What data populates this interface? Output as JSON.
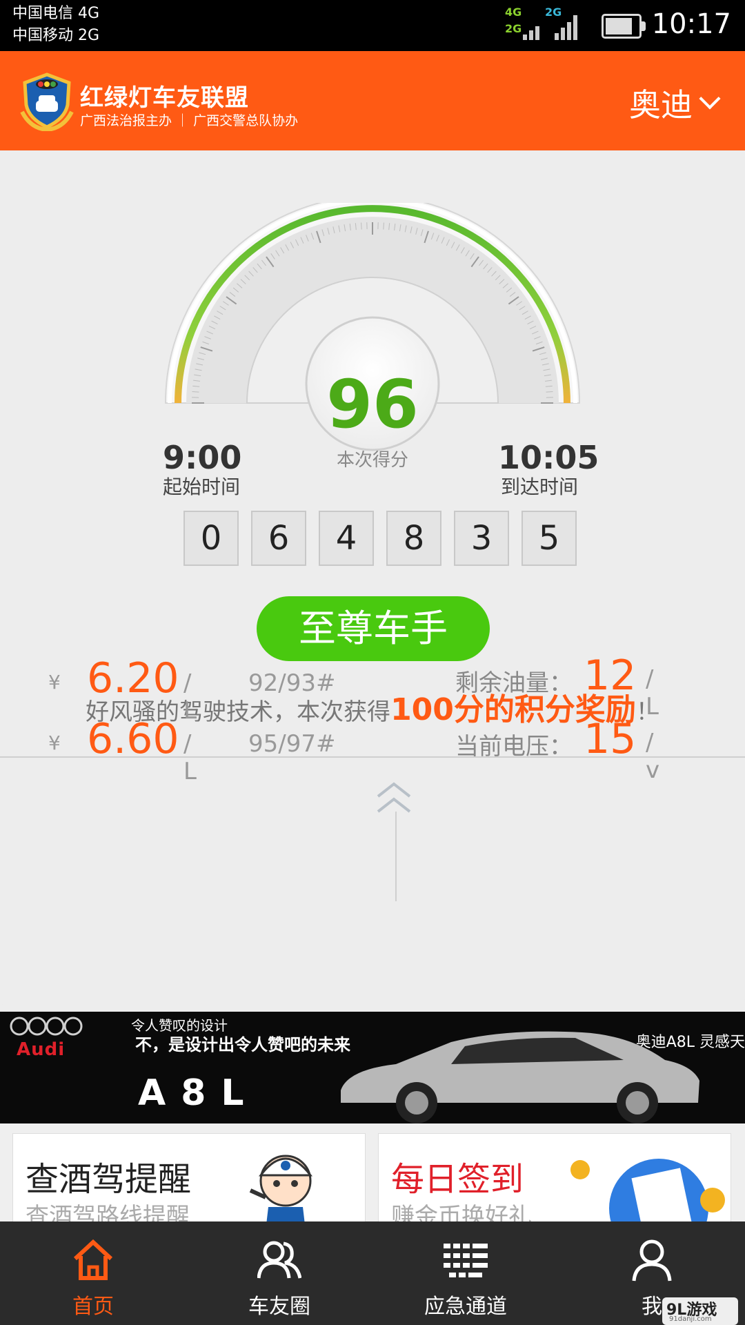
{
  "status_bar": {
    "carrier_1": "中国电信 4G",
    "carrier_2": "中国移动 2G",
    "net_tag_1": "4G",
    "net_tag_2": "2G",
    "net_tag_3": "2G",
    "time": "10:17"
  },
  "header": {
    "title": "红绿灯车友联盟",
    "subtitle": "广西法治报主办 ｜ 广西交警总队协办",
    "brand_selector": "奥迪"
  },
  "gauge": {
    "score": "96",
    "score_label": "本次得分",
    "score_fraction": 0.96,
    "start_time": "9:00",
    "start_time_label": "起始时间",
    "arrival_time": "10:05",
    "arrival_time_label": "到达时间"
  },
  "odometer": [
    "0",
    "6",
    "4",
    "8",
    "3",
    "5"
  ],
  "rank_button": "至尊车手",
  "message": {
    "prefix": "好风骚的驾驶技术，本次获得",
    "highlight": "100分的积分奖励",
    "suffix": "！"
  },
  "fuel_prices": [
    {
      "currency": "¥",
      "price": "6.20",
      "unit": "/ L",
      "grade": "92/93#"
    },
    {
      "currency": "¥",
      "price": "6.60",
      "unit": "/ L",
      "grade": "95/97#"
    }
  ],
  "vehicle_info": [
    {
      "label": "剩余油量：",
      "value": "12",
      "unit": "/ L"
    },
    {
      "label": "当前电压：",
      "value": "15",
      "unit": "/ v"
    }
  ],
  "ad_banner": {
    "slogan_line1": "令人赞叹的设计",
    "slogan_line2": "不，是设计出令人赞吧的未来",
    "brand": "Audi",
    "model": "A8L",
    "tagline": "奥迪A8L 灵感天"
  },
  "tiles": [
    {
      "title": "查酒驾提醒",
      "subtitle": "查酒驾路线提醒"
    },
    {
      "title": "每日签到",
      "subtitle": "赚金币换好礼"
    }
  ],
  "tabs": [
    {
      "label": "首页",
      "icon": "home-icon"
    },
    {
      "label": "车友圈",
      "icon": "group-icon"
    },
    {
      "label": "应急通道",
      "icon": "list-icon"
    },
    {
      "label": "我",
      "icon": "user-icon"
    }
  ],
  "watermark": {
    "text": "9L游戏",
    "sub": "91danji.com"
  },
  "colors": {
    "accent": "#ff5a14",
    "score_green": "#4caa18",
    "button_green": "#49c90f",
    "tabbar": "#2b2b2b"
  }
}
